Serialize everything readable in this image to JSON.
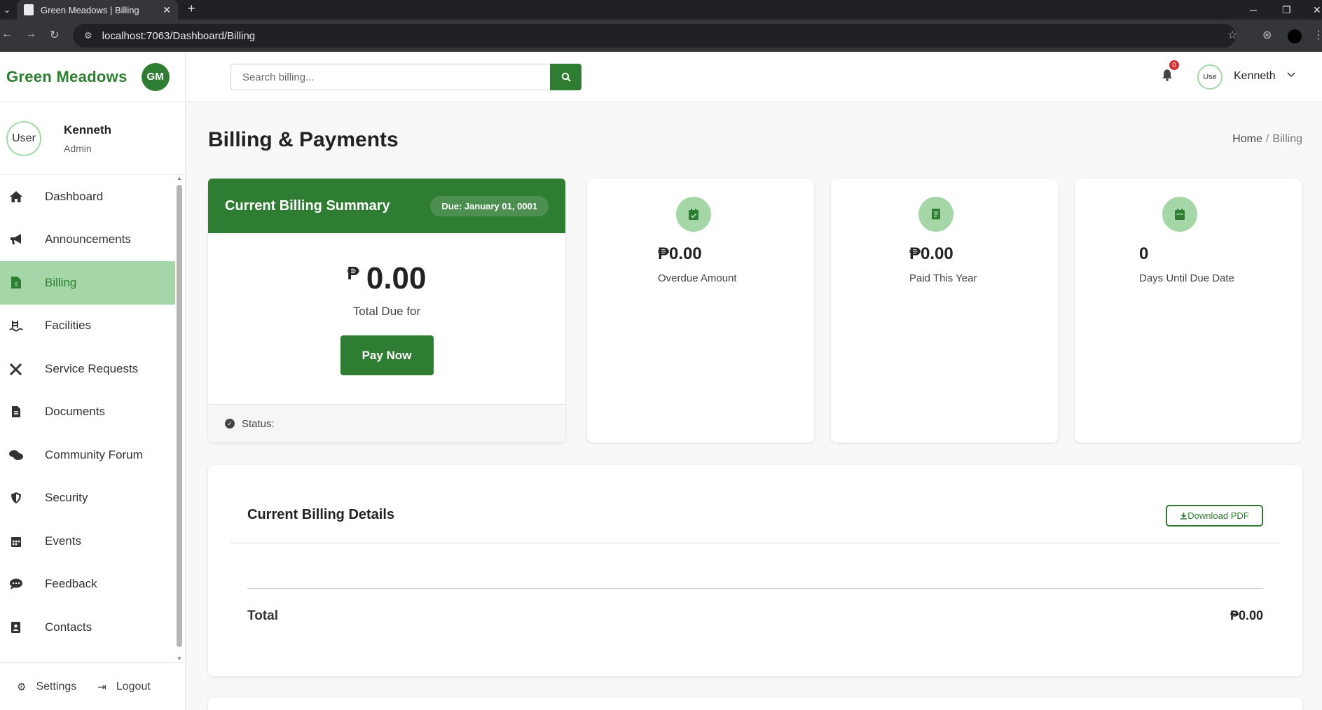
{
  "browser": {
    "tab_title": "Green Meadows | Billing",
    "url": "localhost:7063/Dashboard/Billing"
  },
  "brand": {
    "name": "Green Meadows",
    "logo_text": "GM",
    "color": "#2e7d32",
    "accent": "#a5d6a7"
  },
  "user": {
    "avatar_alt": "User",
    "name": "Kenneth",
    "role": "Admin"
  },
  "sidebar": {
    "items": [
      {
        "label": "Dashboard",
        "icon": "home-icon"
      },
      {
        "label": "Announcements",
        "icon": "megaphone-icon"
      },
      {
        "label": "Billing",
        "icon": "invoice-icon",
        "active": true
      },
      {
        "label": "Facilities",
        "icon": "pool-icon"
      },
      {
        "label": "Service Requests",
        "icon": "tools-icon"
      },
      {
        "label": "Documents",
        "icon": "file-icon"
      },
      {
        "label": "Community Forum",
        "icon": "comments-icon"
      },
      {
        "label": "Security",
        "icon": "shield-icon"
      },
      {
        "label": "Events",
        "icon": "calendar-icon"
      },
      {
        "label": "Feedback",
        "icon": "chat-icon"
      },
      {
        "label": "Contacts",
        "icon": "address-book-icon"
      }
    ],
    "footer": {
      "settings_label": "Settings",
      "logout_label": "Logout"
    }
  },
  "topbar": {
    "search_placeholder": "Search billing...",
    "notification_count": "0",
    "avatar_alt": "Use",
    "user_name": "Kenneth"
  },
  "page": {
    "title": "Billing & Payments",
    "breadcrumb": {
      "home": "Home",
      "separator": "/",
      "current": "Billing"
    }
  },
  "summary": {
    "title": "Current Billing Summary",
    "due_badge": "Due: January 01, 0001",
    "currency_symbol": "₱",
    "amount": "0.00",
    "total_due_label": "Total Due for",
    "pay_button": "Pay Now",
    "status_label": "Status:"
  },
  "stats": [
    {
      "icon": "calendar-check-icon",
      "value": "₱0.00",
      "label": "Overdue Amount"
    },
    {
      "icon": "receipt-icon",
      "value": "₱0.00",
      "label": "Paid This Year"
    },
    {
      "icon": "calendar-icon",
      "value": "0",
      "label": "Days Until Due Date"
    }
  ],
  "details": {
    "title": "Current Billing Details",
    "download_label": "Download PDF",
    "total_label": "Total",
    "total_value": "₱0.00"
  }
}
